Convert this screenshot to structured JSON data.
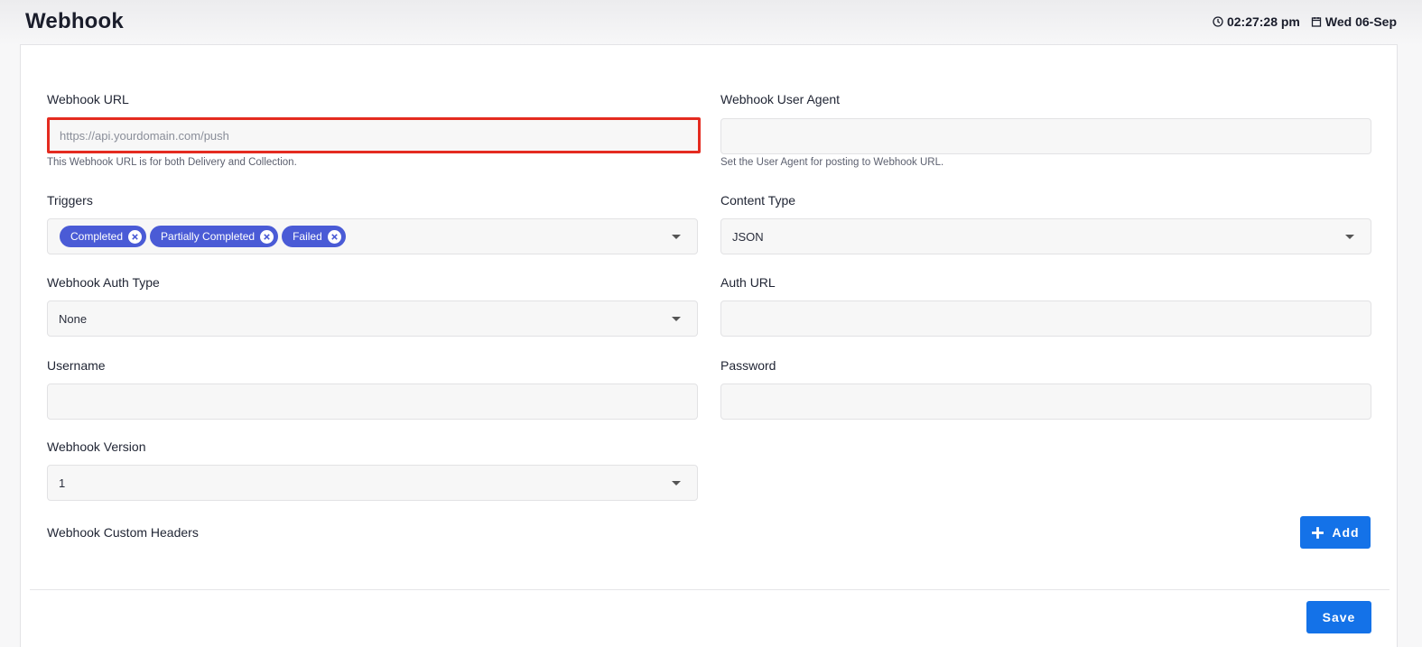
{
  "header": {
    "title": "Webhook",
    "time": "02:27:28 pm",
    "date": "Wed 06-Sep"
  },
  "form": {
    "webhook_url": {
      "label": "Webhook URL",
      "placeholder": "https://api.yourdomain.com/push",
      "value": "",
      "help": "This Webhook URL is for both Delivery and Collection."
    },
    "user_agent": {
      "label": "Webhook User Agent",
      "value": "",
      "help": "Set the User Agent for posting to Webhook URL."
    },
    "triggers": {
      "label": "Triggers",
      "selected": [
        "Completed",
        "Partially Completed",
        "Failed"
      ]
    },
    "content_type": {
      "label": "Content Type",
      "value": "JSON"
    },
    "auth_type": {
      "label": "Webhook Auth Type",
      "value": "None"
    },
    "auth_url": {
      "label": "Auth URL",
      "value": ""
    },
    "username": {
      "label": "Username",
      "value": ""
    },
    "password": {
      "label": "Password",
      "value": ""
    },
    "version": {
      "label": "Webhook Version",
      "value": "1"
    },
    "custom_headers": {
      "label": "Webhook Custom Headers",
      "add_label": "Add"
    }
  },
  "footer": {
    "save_label": "Save"
  },
  "colors": {
    "accent": "#1472e8",
    "chip": "#4a5bd6",
    "highlight": "#e42b20"
  }
}
